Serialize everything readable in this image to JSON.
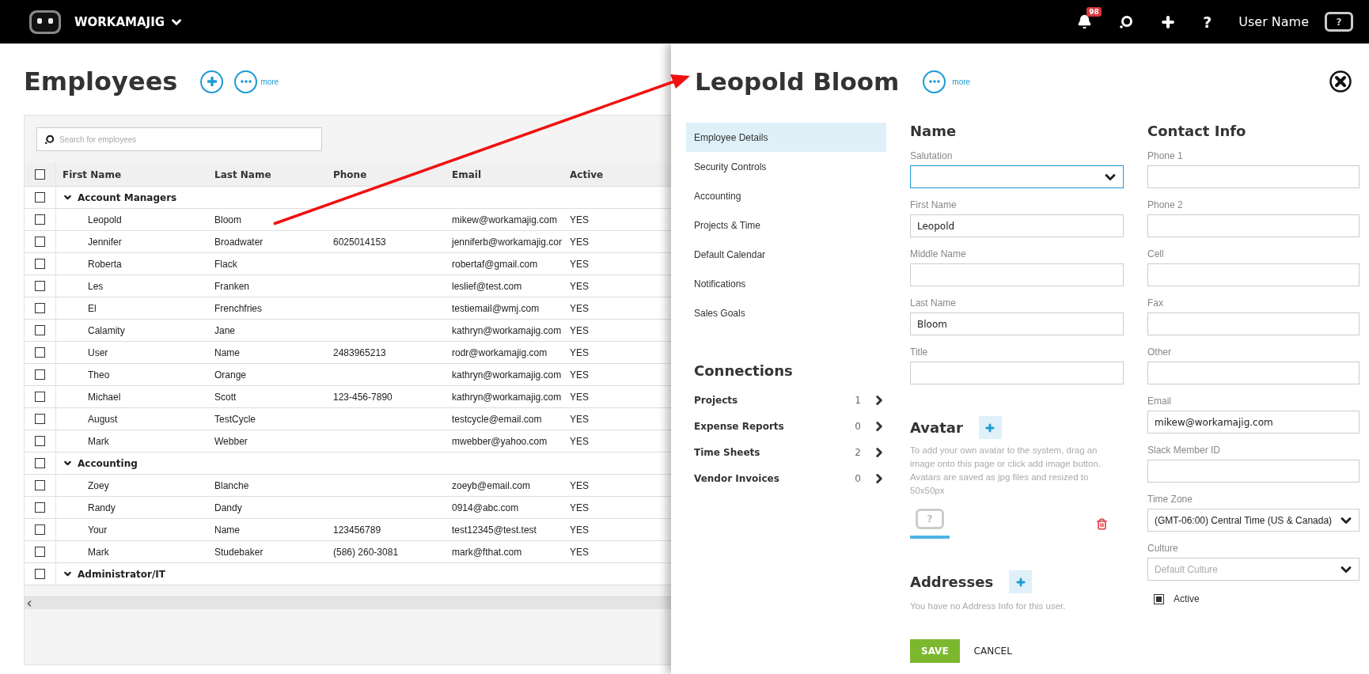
{
  "topbar": {
    "brand": "WORKAMAJIG",
    "notification_count": "98",
    "help": "?",
    "user_name": "User Name",
    "user_avatar_glyph": "?"
  },
  "employees": {
    "title": "Employees",
    "more_label": "more",
    "search": {
      "placeholder": "Search for employees"
    },
    "header_checked": false,
    "columns": [
      "First Name",
      "Last Name",
      "Phone",
      "Email",
      "Active"
    ],
    "groups": [
      {
        "name": "Account Managers",
        "expanded": true,
        "checked": false,
        "rows": [
          {
            "first": "Leopold",
            "last": "Bloom",
            "phone": "",
            "email": "mikew@workamajig.com",
            "active": "YES",
            "checked": false
          },
          {
            "first": "Jennifer",
            "last": "Broadwater",
            "phone": "6025014153",
            "email": "jenniferb@workamajig.cor",
            "active": "YES",
            "checked": false
          },
          {
            "first": "Roberta",
            "last": "Flack",
            "phone": "",
            "email": "robertaf@gmail.com",
            "active": "YES",
            "checked": false
          },
          {
            "first": "Les",
            "last": "Franken",
            "phone": "",
            "email": "leslief@test.com",
            "active": "YES",
            "checked": false
          },
          {
            "first": "El",
            "last": "Frenchfries",
            "phone": "",
            "email": "testiemail@wmj.com",
            "active": "YES",
            "checked": false
          },
          {
            "first": "Calamity",
            "last": "Jane",
            "phone": "",
            "email": "kathryn@workamajig.com",
            "active": "YES",
            "checked": false
          },
          {
            "first": "User",
            "last": "Name",
            "phone": "2483965213",
            "email": "rodr@workamajig.com",
            "active": "YES",
            "checked": false
          },
          {
            "first": "Theo",
            "last": "Orange",
            "phone": "",
            "email": "kathryn@workamajig.com",
            "active": "YES",
            "checked": false
          },
          {
            "first": "Michael",
            "last": "Scott",
            "phone": "123-456-7890",
            "email": "kathryn@workamajig.com",
            "active": "YES",
            "checked": false
          },
          {
            "first": "August",
            "last": "TestCycle",
            "phone": "",
            "email": "testcycle@email.com",
            "active": "YES",
            "checked": false
          },
          {
            "first": "Mark",
            "last": "Webber",
            "phone": "",
            "email": "mwebber@yahoo.com",
            "active": "YES",
            "checked": false
          }
        ]
      },
      {
        "name": "Accounting",
        "expanded": true,
        "checked": false,
        "rows": [
          {
            "first": "Zoey",
            "last": "Blanche",
            "phone": "",
            "email": "zoeyb@email.com",
            "active": "YES",
            "checked": false
          },
          {
            "first": "Randy",
            "last": "Dandy",
            "phone": "",
            "email": "0914@abc.com",
            "active": "YES",
            "checked": false
          },
          {
            "first": "Your",
            "last": "Name",
            "phone": "123456789",
            "email": "test12345@test.test",
            "active": "YES",
            "checked": false
          },
          {
            "first": "Mark",
            "last": "Studebaker",
            "phone": "(586) 260-3081",
            "email": "mark@fthat.com",
            "active": "YES",
            "checked": false
          }
        ]
      },
      {
        "name": "Administrator/IT",
        "expanded": true,
        "checked": false
      }
    ]
  },
  "panel": {
    "title": "Leopold Bloom",
    "more_label": "more",
    "nav": [
      {
        "label": "Employee Details",
        "selected": true
      },
      {
        "label": "Security Controls",
        "selected": false
      },
      {
        "label": "Accounting",
        "selected": false
      },
      {
        "label": "Projects & Time",
        "selected": false
      },
      {
        "label": "Default Calendar",
        "selected": false
      },
      {
        "label": "Notifications",
        "selected": false
      },
      {
        "label": "Sales Goals",
        "selected": false
      }
    ],
    "connections": {
      "heading": "Connections",
      "items": [
        {
          "label": "Projects",
          "count": "1"
        },
        {
          "label": "Expense Reports",
          "count": "0"
        },
        {
          "label": "Time Sheets",
          "count": "2"
        },
        {
          "label": "Vendor Invoices",
          "count": "0"
        }
      ]
    },
    "name_section": {
      "heading": "Name",
      "fields": [
        {
          "label": "Salutation",
          "kind": "select",
          "focused": true
        },
        {
          "label": "First Name",
          "kind": "text",
          "value": "Leopold"
        },
        {
          "label": "Middle Name",
          "kind": "text"
        },
        {
          "label": "Last Name",
          "kind": "text",
          "value": "Bloom"
        },
        {
          "label": "Title",
          "kind": "text"
        }
      ]
    },
    "avatar": {
      "heading": "Avatar",
      "help": "To add your own avatar to the system, drag an image onto this page or click add image button. Avatars are saved as jpg files and resized to 50x50px",
      "glyph": "?"
    },
    "addresses": {
      "heading": "Addresses",
      "empty_text": "You have no Address Info for this user."
    },
    "contact_section": {
      "heading": "Contact Info",
      "fields": [
        {
          "label": "Phone 1",
          "kind": "text"
        },
        {
          "label": "Phone 2",
          "kind": "text"
        },
        {
          "label": "Cell",
          "kind": "text"
        },
        {
          "label": "Fax",
          "kind": "text"
        },
        {
          "label": "Other",
          "kind": "text"
        },
        {
          "label": "Email",
          "kind": "text",
          "value": "mikew@workamajig.com"
        },
        {
          "label": "Slack Member ID",
          "kind": "text"
        },
        {
          "label": "Time Zone",
          "kind": "select",
          "value": "(GMT-06:00) Central Time (US & Canada)"
        },
        {
          "label": "Culture",
          "kind": "select",
          "placeholder": "Default Culture"
        }
      ]
    },
    "active": {
      "label": "Active",
      "checked": true
    },
    "save_label": "SAVE",
    "cancel_label": "CANCEL"
  }
}
